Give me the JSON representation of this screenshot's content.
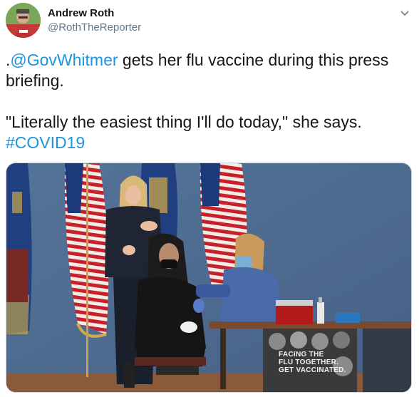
{
  "author": {
    "name": "Andrew Roth",
    "handle": "@RothTheReporter",
    "avatar_icon": "profile-photo"
  },
  "menu_icon": "chevron-down-icon",
  "tweet": {
    "line1_mention": "@GovWhitmer",
    "line1_prefix": ".",
    "line1_rest": " gets her flu vaccine during this press",
    "line2": "briefing.",
    "line3": "\"Literally the easiest thing I'll do today,\" she says.",
    "hashtag": "#COVID19"
  },
  "media": {
    "description_type": "photo",
    "poster_lines": [
      "FACING THE",
      "FLU TOGETHER.",
      "GET VACCINATED."
    ]
  },
  "colors": {
    "link": "#1b95e0",
    "text": "#14171a",
    "muted": "#657786",
    "backdrop": "#4e6a8f"
  }
}
